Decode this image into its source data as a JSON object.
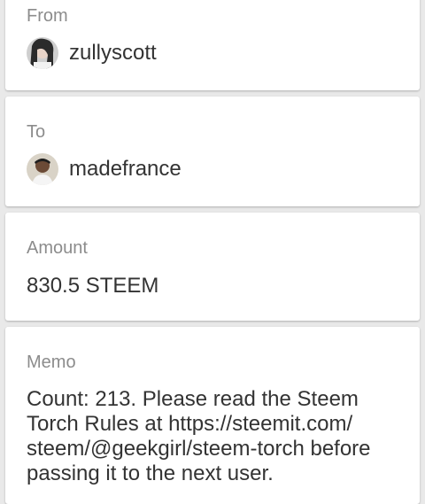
{
  "from": {
    "label": "From",
    "username": "zullyscott",
    "avatar_icon": "user-avatar-zullyscott"
  },
  "to": {
    "label": "To",
    "username": "madefrance",
    "avatar_icon": "user-avatar-madefrance"
  },
  "amount": {
    "label": "Amount",
    "value": "830.5 STEEM"
  },
  "memo": {
    "label": "Memo",
    "lines": [
      "Count: 213. Please read the Steem",
      "Torch Rules at https://steemit.com/",
      "steem/@geekgirl/steem-torch before",
      "passing it to the next user."
    ]
  },
  "colors": {
    "background": "#e9e9e9",
    "card": "#ffffff",
    "label": "#8c8c8c",
    "text": "#333333"
  }
}
